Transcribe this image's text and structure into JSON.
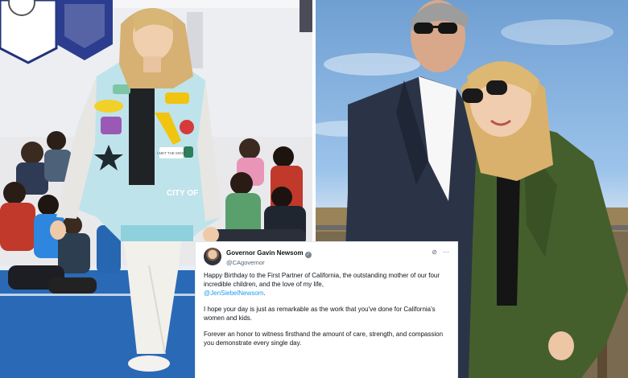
{
  "tweet": {
    "author_name": "Governor Gavin Newsom",
    "verified_mark": "✓",
    "handle": "@CAgovernor",
    "paragraph_1": "Happy Birthday to the First Partner of California, the outstanding mother of our four incredible children, and the love of my life,",
    "mention": "@JenSiebelNewsom",
    "mention_suffix": ".",
    "paragraph_2": "I hope your day is just as remarkable as the work that you've done for California's women and kids.",
    "paragraph_3": "Forever an honor to witness firsthand the amount of care, strength, and compassion you demonstrate every single day.",
    "icons": [
      "grok-icon",
      "more-icon"
    ],
    "icon_glyphs": {
      "grok": "⊘",
      "more": "···"
    }
  },
  "photos": {
    "left": {
      "jacket_patches": [
        "I MET THE MOST",
        "CITY OF"
      ]
    }
  },
  "colors": {
    "mention": "#1d9bf0",
    "sky": "#8ab6e3",
    "blazer_green": "#3f5a2a",
    "jacket_blue": "#bfe3ea",
    "gym_floor": "#1f5fa8"
  }
}
